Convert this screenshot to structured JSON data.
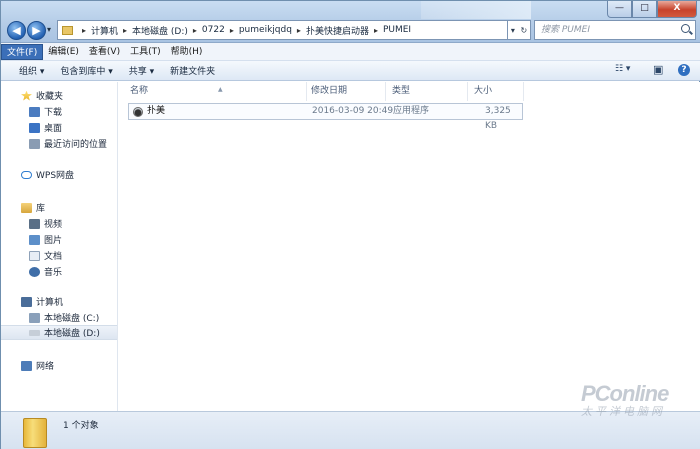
{
  "window": {
    "controls": {
      "minimize": "—",
      "maximize": "□",
      "close": "X"
    }
  },
  "nav": {
    "back_icon": "◀",
    "forward_icon": "▶",
    "dropdown_icon": "▾",
    "address": [
      "计算机",
      "本地磁盘 (D:)",
      "0722",
      "pumeikjqdq",
      "扑美快捷启动器",
      "PUMEI"
    ],
    "address_sep": "▸",
    "refresh_icon": "↻",
    "search_placeholder": "搜索 PUMEI"
  },
  "menu": [
    "文件(F)",
    "编辑(E)",
    "查看(V)",
    "工具(T)",
    "帮助(H)"
  ],
  "toolbar": {
    "organize": "组织 ▾",
    "include": "包含到库中 ▾",
    "share": "共享 ▾",
    "new_folder": "新建文件夹",
    "view_icon": "☷ ▾",
    "pane_icon": "▣",
    "help_icon": "?"
  },
  "sidebar": {
    "favorites": "收藏夹",
    "downloads": "下载",
    "desktop": "桌面",
    "recent": "最近访问的位置",
    "wps": "WPS网盘",
    "libraries": "库",
    "videos": "视频",
    "pictures": "图片",
    "documents": "文档",
    "music": "音乐",
    "computer": "计算机",
    "drive_c": "本地磁盘 (C:)",
    "drive_d": "本地磁盘 (D:)",
    "network": "网络"
  },
  "columns": {
    "name": "名称",
    "date": "修改日期",
    "type": "类型",
    "size": "大小"
  },
  "files": [
    {
      "name": "扑美",
      "date": "2016-03-09 20:49",
      "type": "应用程序",
      "size": "3,325 KB"
    }
  ],
  "status": {
    "count": "1 个对象"
  },
  "watermark": {
    "line1": "PConline",
    "line2": "太平洋电脑网"
  }
}
